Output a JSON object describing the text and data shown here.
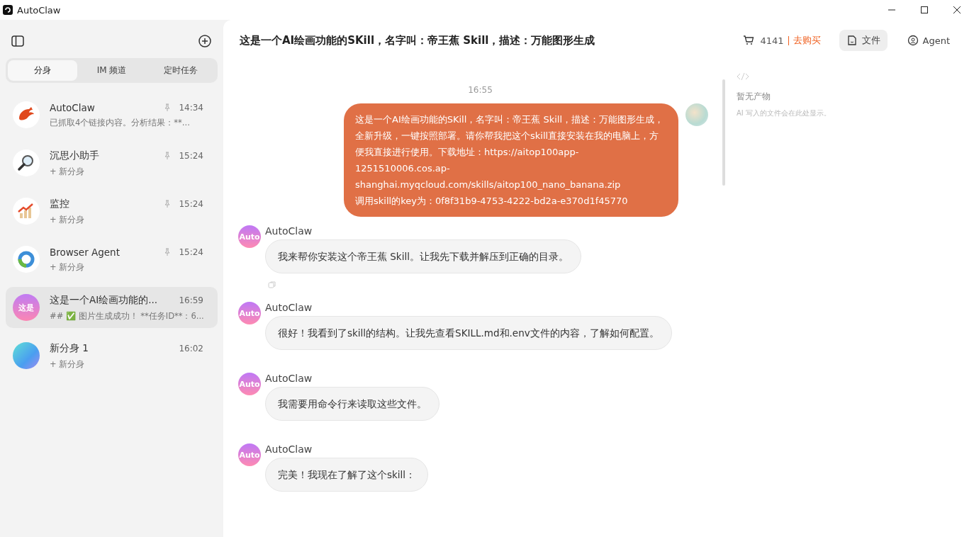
{
  "window": {
    "title": "AutoClaw"
  },
  "sidebar": {
    "tabs": [
      {
        "label": "分身",
        "selected": true
      },
      {
        "label": "IM 频道",
        "selected": false
      },
      {
        "label": "定时任务",
        "selected": false
      }
    ],
    "items": [
      {
        "name": "AutoClaw",
        "time": "14:34",
        "preview": "已抓取4个链接内容。分析结果：**...",
        "pinned": true,
        "selected": false,
        "kind": "lobster"
      },
      {
        "name": "沉思小助手",
        "time": "15:24",
        "preview": "+ 新分身",
        "pinned": true,
        "selected": false,
        "kind": "magnifier"
      },
      {
        "name": "监控",
        "time": "15:24",
        "preview": "+ 新分身",
        "pinned": true,
        "selected": false,
        "kind": "chart"
      },
      {
        "name": "Browser Agent",
        "time": "15:24",
        "preview": "+ 新分身",
        "pinned": true,
        "selected": false,
        "kind": "ring"
      },
      {
        "name": "这是一个AI绘画功能的...",
        "time": "16:59",
        "preview": "## ✅ 图片生成成功！ **任务ID**：6...",
        "pinned": false,
        "selected": true,
        "kind": "text",
        "avatar_text": "这是"
      },
      {
        "name": "新分身 1",
        "time": "16:02",
        "preview": "+ 新分身",
        "pinned": false,
        "selected": false,
        "kind": "gradient"
      }
    ]
  },
  "header": {
    "title": "这是一个AI绘画功能的SKill，名字叫：帝王蕉 Skill，描述：万能图形生成",
    "credits": "4141",
    "buy": "去购买",
    "files_button": "文件",
    "agent_button": "Agent"
  },
  "chat": {
    "time": "16:55",
    "user_message": "这是一个AI绘画功能的SKill，名字叫：帝王蕉 Skill，描述：万能图形生成，全新升级，一键按照部署。请你帮我把这个skill直接安装在我的电脑上，方便我直接进行使用。下载地址：https://aitop100app-1251510006.cos.ap-shanghai.myqcloud.com/skills/aitop100_nano_banana.zip\n调用skill的key为：0f8f31b9-4753-4222-bd2a-e370d1f45770",
    "messages": [
      {
        "sender": "AutoClaw",
        "avatar_text": "Auto",
        "text": "我来帮你安装这个帝王蕉 Skill。让我先下载并解压到正确的目录。",
        "copy": true
      },
      {
        "sender": "AutoClaw",
        "avatar_text": "Auto",
        "text": "很好！我看到了skill的结构。让我先查看SKILL.md和.env文件的内容，了解如何配置。",
        "copy": false
      },
      {
        "sender": "AutoClaw",
        "avatar_text": "Auto",
        "text": "我需要用命令行来读取这些文件。",
        "copy": false
      },
      {
        "sender": "AutoClaw",
        "avatar_text": "Auto",
        "text": "完美！我现在了解了这个skill：",
        "copy": false
      }
    ]
  },
  "artifacts": {
    "title": "暂无产物",
    "hint": "AI 写入的文件会在此处显示。"
  }
}
